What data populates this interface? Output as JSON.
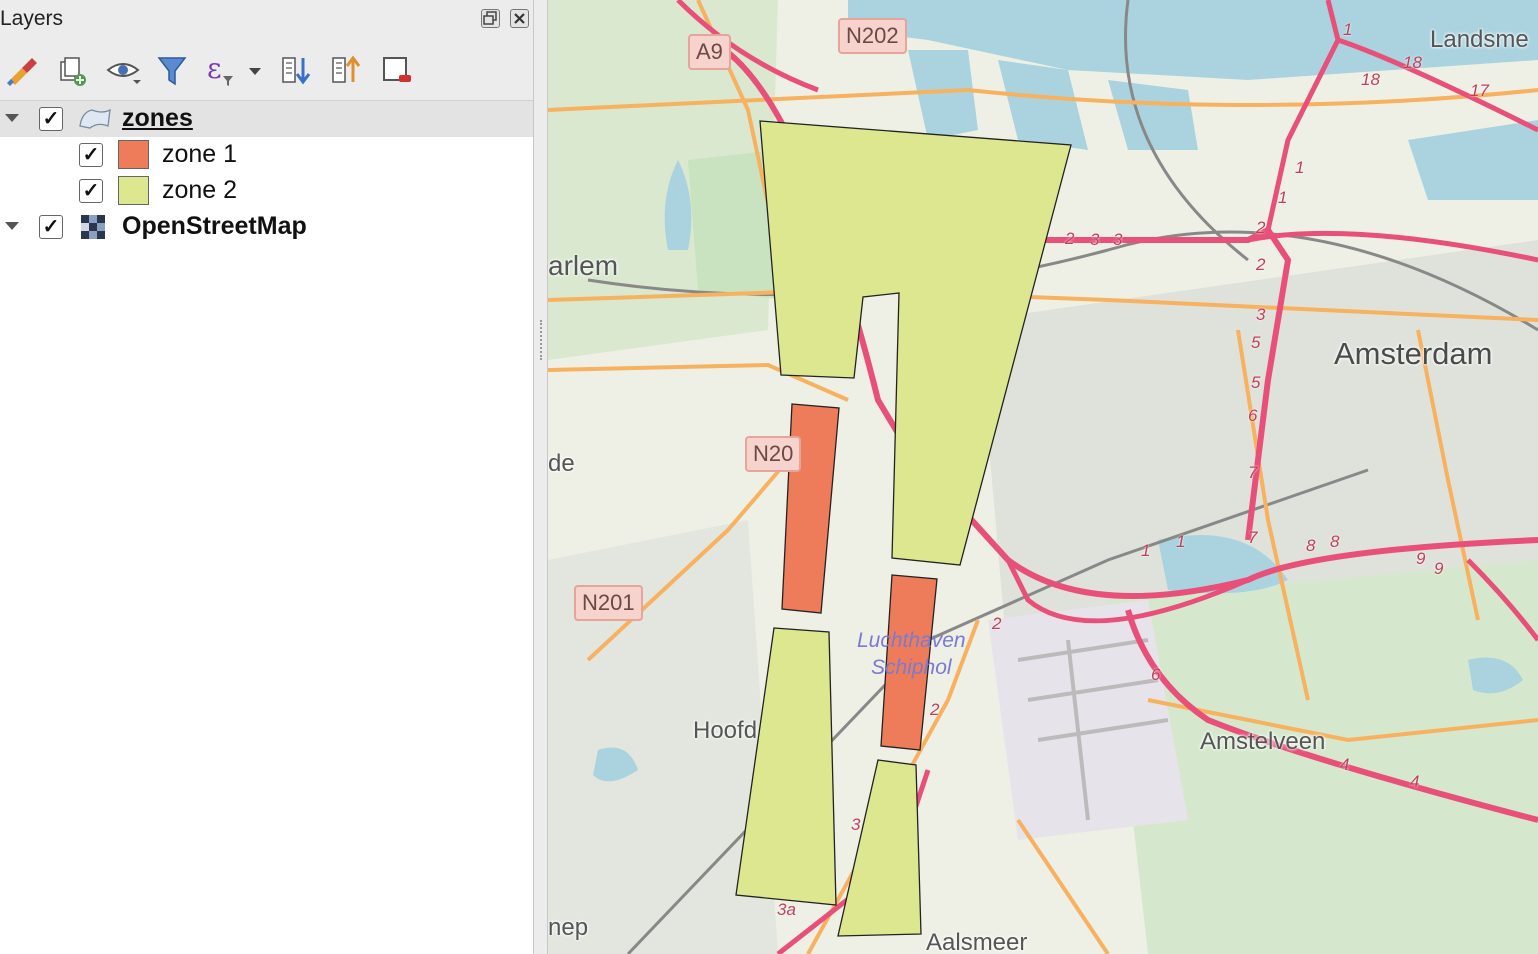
{
  "layers_panel": {
    "title": "Layers",
    "toolbar": {
      "icons": [
        "style-manager-icon",
        "add-group-icon",
        "visibility-eye-icon",
        "filter-icon",
        "expression-filter-icon",
        "expand-all-icon",
        "collapse-all-icon",
        "remove-layer-icon"
      ]
    },
    "tree": {
      "zones": {
        "label": "zones",
        "checked": true,
        "expanded": true,
        "selected": true
      },
      "zone1": {
        "label": "zone 1",
        "checked": true,
        "color": "#ee7c5a"
      },
      "zone2": {
        "label": "zone 2",
        "checked": true,
        "color": "#dde78f"
      },
      "osm": {
        "label": "OpenStreetMap",
        "checked": true,
        "expanded": false
      }
    }
  },
  "map": {
    "road_shields": [
      "A9",
      "N202",
      "N20",
      "N201"
    ],
    "places": {
      "landsmeer": "Landsme",
      "haarlem": "arlem",
      "amsterdam": "Amsterdam",
      "heemstede": "de",
      "hoofddorp": "Hoofd",
      "amstelveen": "Amstelveen",
      "aalsmeer": "Aalsmeer",
      "nieuw_vennep": "nep"
    },
    "airport": [
      "Luchthaven",
      "Schiphol"
    ],
    "route_numbers": [
      "1",
      "18",
      "18",
      "17",
      "1",
      "1",
      "2",
      "3",
      "3",
      "2",
      "2",
      "3",
      "5",
      "5",
      "6",
      "7",
      "7",
      "1",
      "1",
      "8",
      "8",
      "9",
      "9",
      "2",
      "6",
      "2",
      "4",
      "4",
      "3",
      "3a"
    ],
    "colors": {
      "zone1_fill": "#ee7c5a",
      "zone2_fill": "#dde78f",
      "water": "#aad3df",
      "highway": "#e8507a",
      "primary_road": "#f7b15f",
      "background": "#eef0e6"
    }
  }
}
